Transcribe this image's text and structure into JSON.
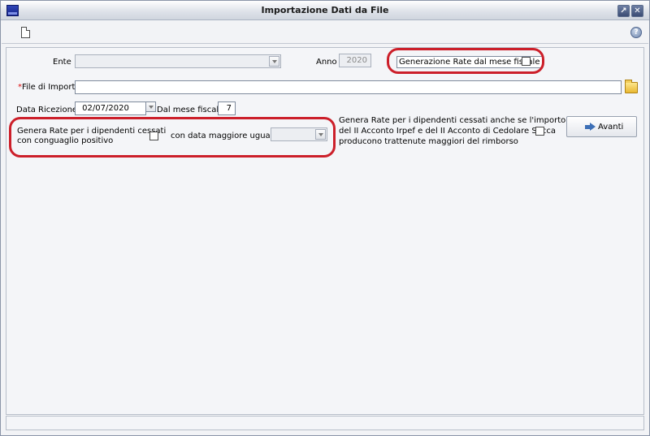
{
  "window": {
    "title": "Importazione Dati da File",
    "restore_glyph": "↗",
    "close_glyph": "✕"
  },
  "toolbar": {
    "new_icon": "new-document-icon",
    "help_icon": "help-icon",
    "help_glyph": "?"
  },
  "form": {
    "ente_label": "Ente",
    "ente_value": "",
    "anno_label": "Anno",
    "anno_value": "2020",
    "generazione_label": "Generazione Rate dal mese fiscale",
    "file_required_marker": "*",
    "file_label": "File di Import",
    "file_value": "",
    "data_ricezione_label": "Data Ricezione",
    "data_ricezione_value": "02/07/2020",
    "dal_mese_label": "Dal mese fiscale",
    "dal_mese_value": "7",
    "cessati_line1": "Genera Rate per i dipendenti cessati",
    "cessati_line2": "con conguaglio positivo",
    "data_maggiore_label": "con data maggiore uguale a",
    "data_maggiore_value": "",
    "acconto_line1": "Genera Rate per i dipendenti cessati anche se l'importo",
    "acconto_line2": "del II Acconto Irpef e del II Acconto di Cedolare Secca",
    "acconto_line3": "producono trattenute maggiori del rimborso",
    "avanti_label": "Avanti"
  },
  "colors": {
    "highlight": "#cc1f2a",
    "accent": "#3d6fb6"
  }
}
